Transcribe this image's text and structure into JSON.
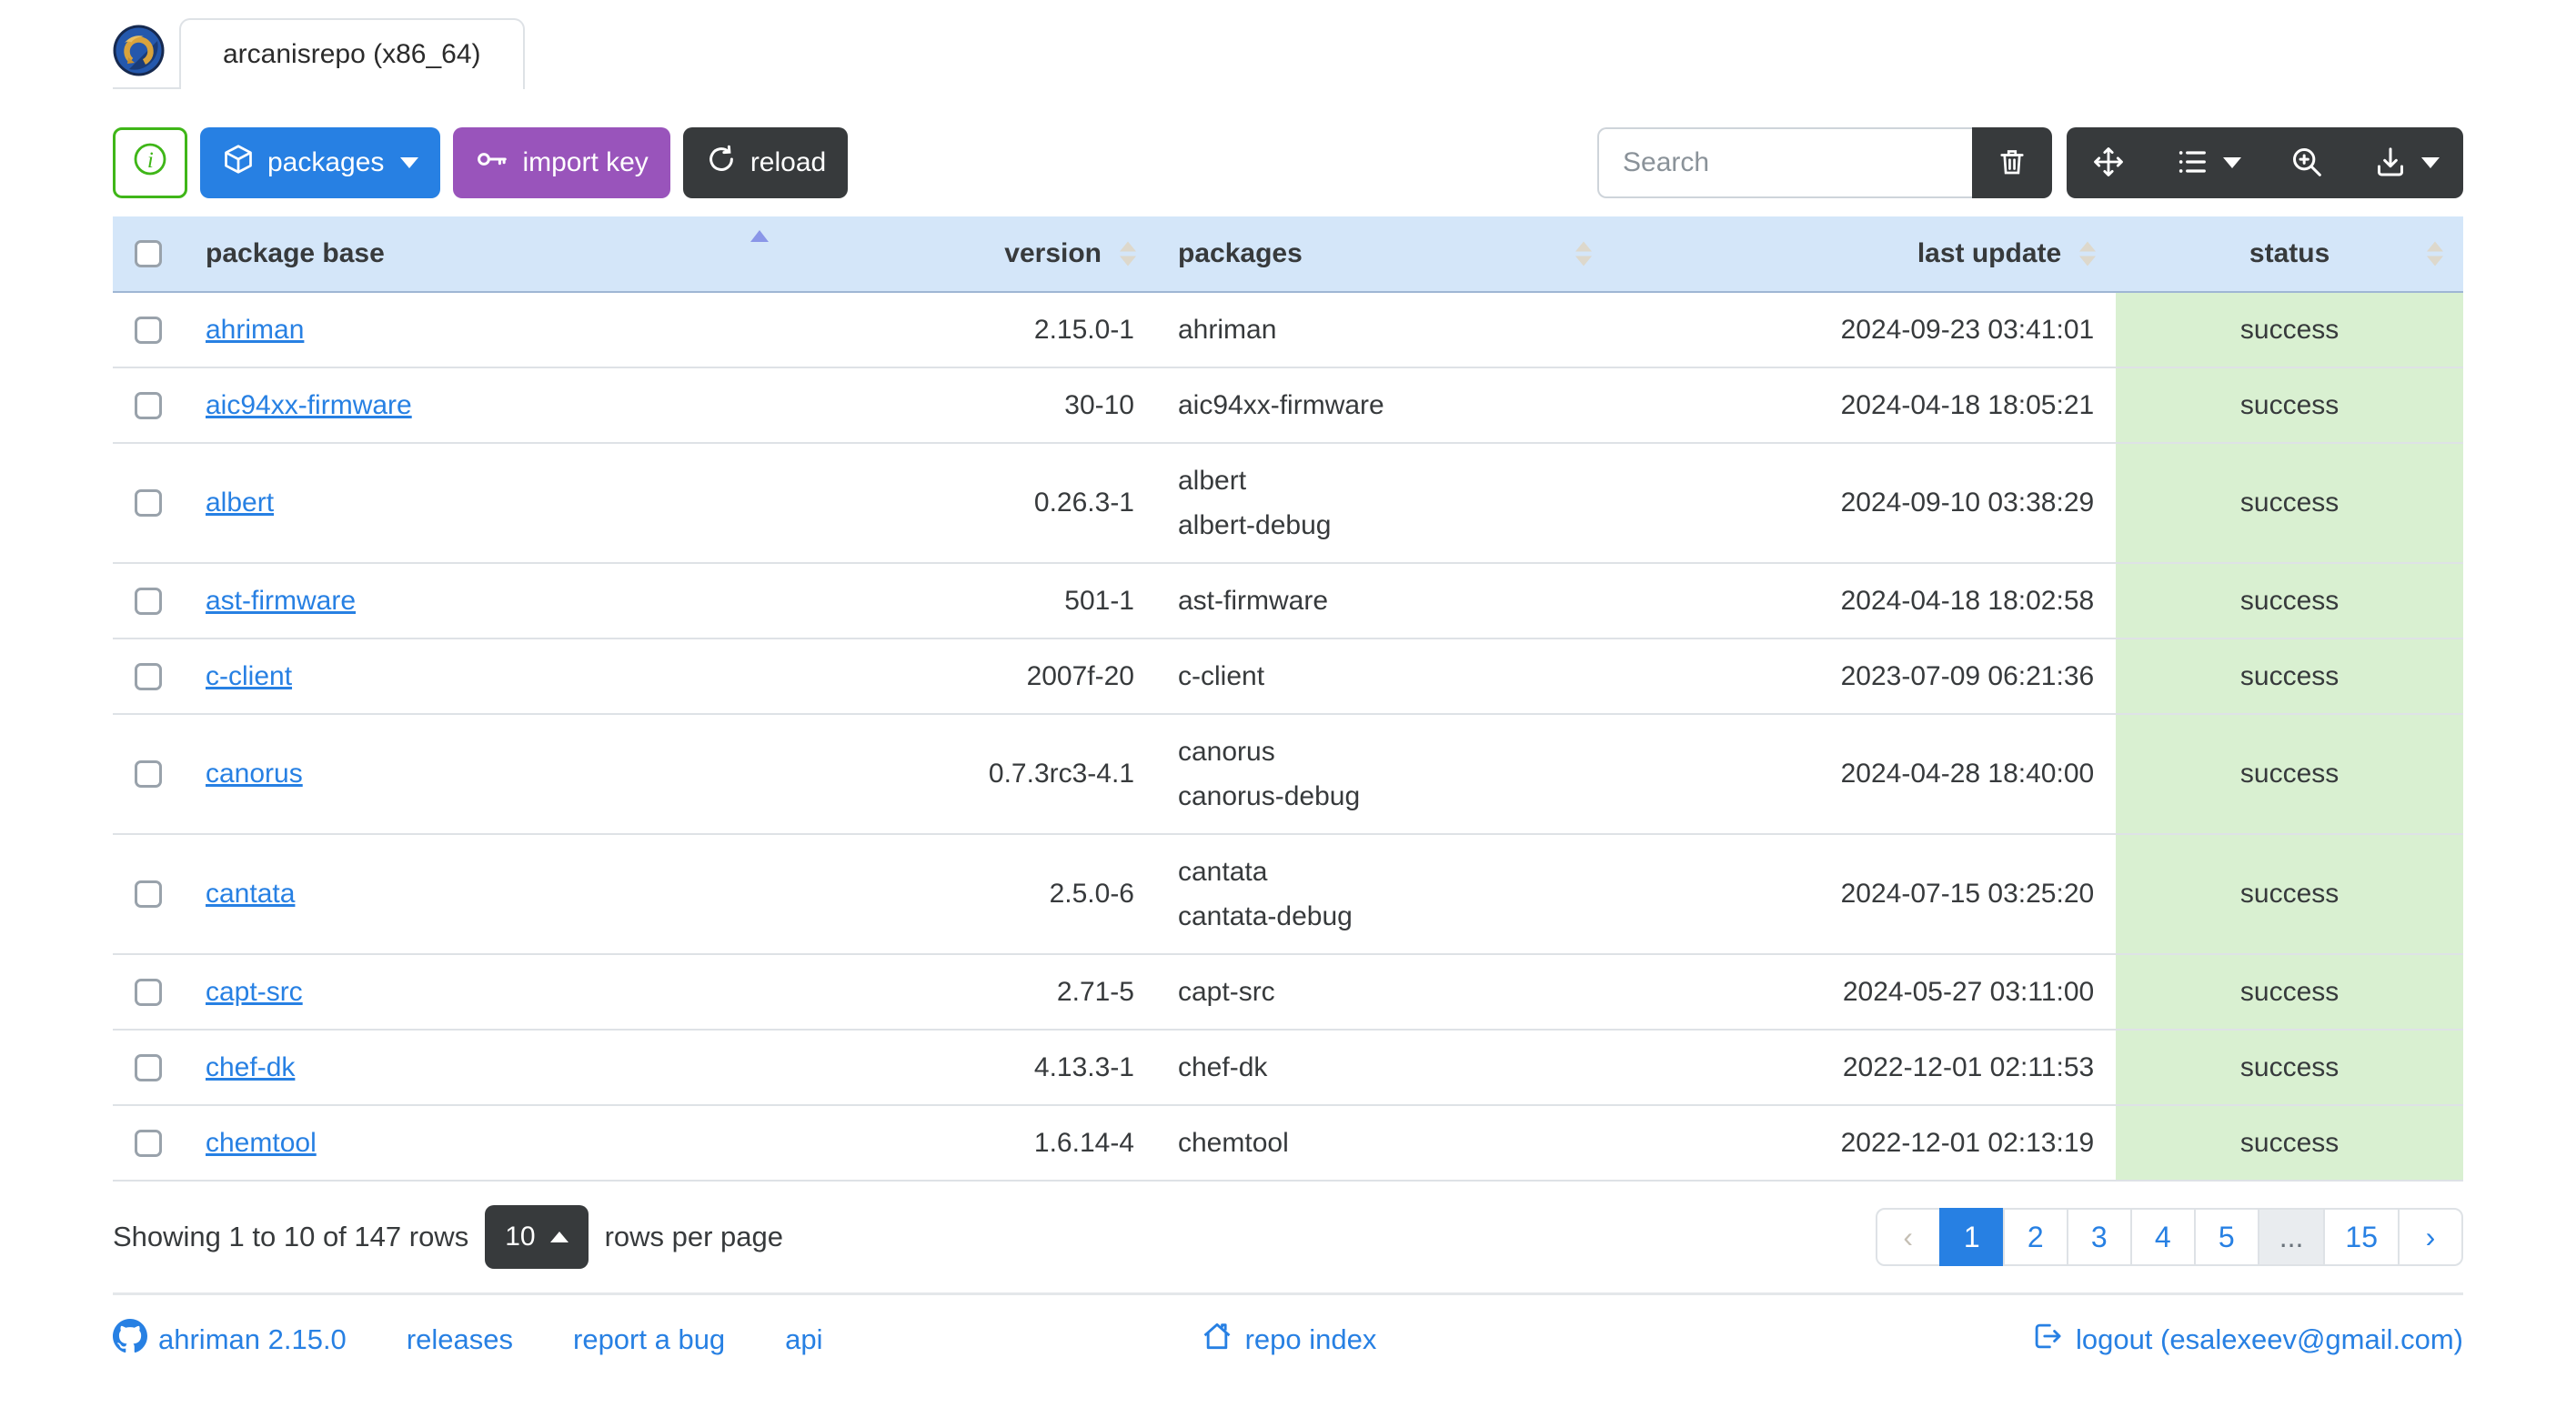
{
  "header": {
    "tab_label": "arcanisrepo (x86_64)"
  },
  "toolbar": {
    "packages_label": "packages",
    "import_key_label": "import key",
    "reload_label": "reload",
    "search_placeholder": "Search"
  },
  "table": {
    "headers": {
      "package_base": "package base",
      "version": "version",
      "packages": "packages",
      "last_update": "last update",
      "status": "status"
    },
    "sort": {
      "column": "package base",
      "direction": "asc"
    },
    "rows": [
      {
        "base": "ahriman",
        "version": "2.15.0-1",
        "packages": [
          "ahriman"
        ],
        "last_update": "2024-09-23 03:41:01",
        "status": "success"
      },
      {
        "base": "aic94xx-firmware",
        "version": "30-10",
        "packages": [
          "aic94xx-firmware"
        ],
        "last_update": "2024-04-18 18:05:21",
        "status": "success"
      },
      {
        "base": "albert",
        "version": "0.26.3-1",
        "packages": [
          "albert",
          "albert-debug"
        ],
        "last_update": "2024-09-10 03:38:29",
        "status": "success"
      },
      {
        "base": "ast-firmware",
        "version": "501-1",
        "packages": [
          "ast-firmware"
        ],
        "last_update": "2024-04-18 18:02:58",
        "status": "success"
      },
      {
        "base": "c-client",
        "version": "2007f-20",
        "packages": [
          "c-client"
        ],
        "last_update": "2023-07-09 06:21:36",
        "status": "success"
      },
      {
        "base": "canorus",
        "version": "0.7.3rc3-4.1",
        "packages": [
          "canorus",
          "canorus-debug"
        ],
        "last_update": "2024-04-28 18:40:00",
        "status": "success"
      },
      {
        "base": "cantata",
        "version": "2.5.0-6",
        "packages": [
          "cantata",
          "cantata-debug"
        ],
        "last_update": "2024-07-15 03:25:20",
        "status": "success"
      },
      {
        "base": "capt-src",
        "version": "2.71-5",
        "packages": [
          "capt-src"
        ],
        "last_update": "2024-05-27 03:11:00",
        "status": "success"
      },
      {
        "base": "chef-dk",
        "version": "4.13.3-1",
        "packages": [
          "chef-dk"
        ],
        "last_update": "2022-12-01 02:11:53",
        "status": "success"
      },
      {
        "base": "chemtool",
        "version": "1.6.14-4",
        "packages": [
          "chemtool"
        ],
        "last_update": "2022-12-01 02:13:19",
        "status": "success"
      }
    ]
  },
  "pagination": {
    "showing": "Showing 1 to 10 of 147 rows",
    "page_size": "10",
    "rows_per_page": "rows per page",
    "items": [
      {
        "label": "‹",
        "state": "disabled"
      },
      {
        "label": "1",
        "state": "active"
      },
      {
        "label": "2",
        "state": "normal"
      },
      {
        "label": "3",
        "state": "normal"
      },
      {
        "label": "4",
        "state": "normal"
      },
      {
        "label": "5",
        "state": "normal"
      },
      {
        "label": "...",
        "state": "separator"
      },
      {
        "label": "15",
        "state": "normal"
      },
      {
        "label": "›",
        "state": "normal"
      }
    ]
  },
  "footer": {
    "version_label": "ahriman 2.15.0",
    "releases": "releases",
    "report_bug": "report a bug",
    "api": "api",
    "repo_index": "repo index",
    "logout": "logout (esalexeev@gmail.com)"
  },
  "colors": {
    "primary": "#2780e3",
    "info_purple": "#9954bb",
    "dark": "#373a3c",
    "success": "#3fb618",
    "table_header_bg": "#d4e6f9",
    "status_success_bg": "#d9f0d1",
    "link": "#2780e3"
  }
}
